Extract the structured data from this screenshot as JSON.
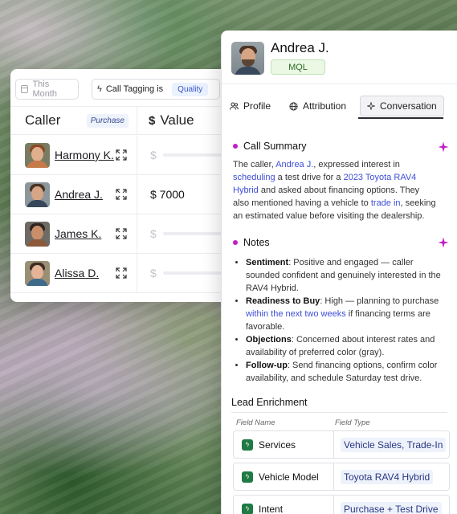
{
  "filters": {
    "date": "This Month",
    "tag_label": "Call Tagging is",
    "tag_value": "Quality"
  },
  "table": {
    "caller_header": "Caller",
    "purchase_badge": "Purchase",
    "value_header": "Value",
    "rows": [
      {
        "name": "Harmony K.",
        "value": "",
        "placeholder": "$"
      },
      {
        "name": "Andrea J.",
        "value": "$ 7000",
        "placeholder": ""
      },
      {
        "name": "James K.",
        "value": "",
        "placeholder": "$"
      },
      {
        "name": "Alissa D.",
        "value": "",
        "placeholder": "$"
      }
    ]
  },
  "panel": {
    "name": "Andrea J.",
    "status": "MQL",
    "tabs": [
      {
        "label": "Profile",
        "icon": "people-icon"
      },
      {
        "label": "Attribution",
        "icon": "globe-icon"
      },
      {
        "label": "Conversation",
        "icon": "sparkle-icon",
        "active": true
      }
    ],
    "call_summary": {
      "title": "Call Summary",
      "t1": "The caller, ",
      "h1": "Andrea J.",
      "t2": ", expressed interest in ",
      "h2": "scheduling",
      "t3": " a test drive for a ",
      "h3": "2023 Toyota RAV4 Hybrid",
      "t4": " and asked about financing options. They also mentioned having a vehicle to ",
      "h4": "trade in",
      "t5": ", seeking an estimated value before visiting the dealership."
    },
    "notes": {
      "title": "Notes",
      "items": [
        {
          "label": "Sentiment",
          "text": ": Positive and engaged — caller sounded confident and genuinely interested in the RAV4 Hybrid."
        },
        {
          "label": "Readiness to Buy",
          "text": ": High — planning to purchase ",
          "highlight": "within the next two weeks",
          "text2": " if financing terms are favorable."
        },
        {
          "label": "Objections",
          "text": ": Concerned about interest rates and availability of preferred color (gray)."
        },
        {
          "label": "Follow-up",
          "text": ": Send financing options, confirm color availability, and schedule Saturday test drive."
        }
      ]
    },
    "lead_enrichment": {
      "title": "Lead Enrichment",
      "field_name_header": "Field Name",
      "field_type_header": "Field Type",
      "rows": [
        {
          "name": "Services",
          "type": "Vehicle Sales, Trade-In"
        },
        {
          "name": "Vehicle Model",
          "type": "Toyota RAV4 Hybrid"
        },
        {
          "name": "Intent",
          "type": "Purchase + Test Drive"
        }
      ]
    }
  },
  "colors": {
    "accent_purple": "#c21fc6",
    "link_blue": "#3d4ed8",
    "mql_green": "#2f6a25",
    "enrich_icon_green": "#1f7a44"
  }
}
